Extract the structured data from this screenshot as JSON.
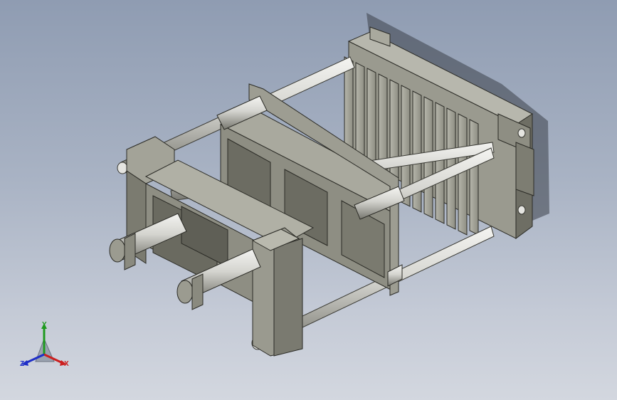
{
  "viewport": {
    "background_top": "#8f9cb2",
    "background_bottom": "#d3d7df",
    "model_color": "#8c8c80",
    "rod_color": "#d6d6d2"
  },
  "triad": {
    "x_label": "X",
    "y_label": "Y",
    "z_label": "Z",
    "x_color": "#cc1f1f",
    "y_color": "#1f9a1f",
    "z_color": "#1f2fc8"
  }
}
